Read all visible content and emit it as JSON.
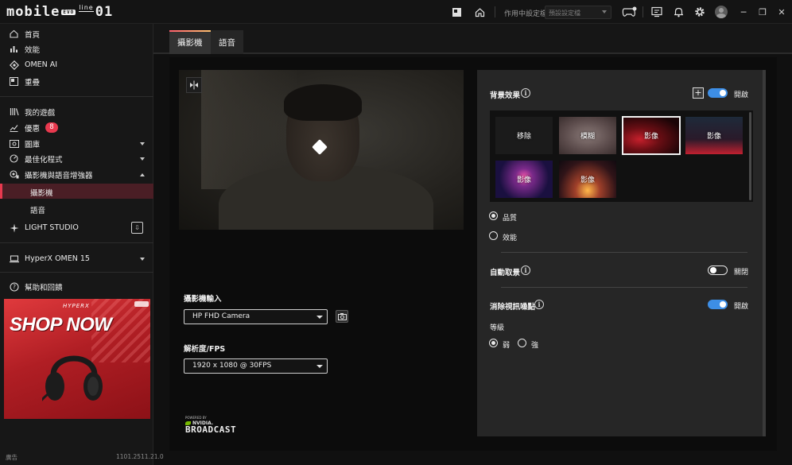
{
  "app": {
    "logo_text": "mobile",
    "logo_evo": "EVO",
    "logo_line": "line",
    "logo_suffix": "01",
    "profile_label": "作用中設定檔",
    "profile_value": "預設設定檔"
  },
  "sidebar": {
    "items": [
      {
        "label": "首頁",
        "icon": "home-icon"
      },
      {
        "label": "效能",
        "icon": "performance-icon"
      },
      {
        "label": "OMEN AI",
        "icon": "omen-ai-icon"
      },
      {
        "label": "重疊",
        "icon": "overlay-icon"
      },
      {
        "label": "我的遊戲",
        "icon": "games-library-icon"
      },
      {
        "label": "優惠",
        "icon": "offers-icon",
        "badge": "8"
      },
      {
        "label": "圖庫",
        "icon": "gallery-icon"
      },
      {
        "label": "最佳化程式",
        "icon": "optimizer-icon"
      },
      {
        "label": "攝影機與語音增強器",
        "icon": "camera-voice-icon"
      },
      {
        "label": "LIGHT STUDIO",
        "icon": "light-studio-icon"
      },
      {
        "label": "HyperX OMEN 15",
        "icon": "laptop-icon"
      },
      {
        "label": "幫助和回饋",
        "icon": "help-icon"
      }
    ],
    "sub_items": [
      {
        "label": "攝影機",
        "active": true
      },
      {
        "label": "語音",
        "active": false
      }
    ],
    "ad": {
      "brand": "HYPERX",
      "headline": "SHOP NOW"
    },
    "footer_left": "廣告",
    "footer_version": "1101.2511.21.0"
  },
  "tabs": [
    {
      "label": "攝影機",
      "active": true
    },
    {
      "label": "語音",
      "active": false
    }
  ],
  "camera": {
    "input_label": "攝影機輸入",
    "input_value": "HP FHD Camera",
    "resolution_label": "解析度/FPS",
    "resolution_value": "1920 x 1080 @ 30FPS",
    "nvidia_powered": "POWERED BY",
    "nvidia_name": "NVIDIA.",
    "nvidia_product": "BROADCAST"
  },
  "panel": {
    "background_effect_label": "背景效果",
    "background_effect_state": "開啟",
    "thumbs": [
      {
        "label": "移除"
      },
      {
        "label": "模糊"
      },
      {
        "label": "影像",
        "selected": true
      },
      {
        "label": "影像"
      },
      {
        "label": "影像"
      },
      {
        "label": "影像"
      }
    ],
    "quality_options": [
      {
        "label": "品質",
        "checked": true
      },
      {
        "label": "效能",
        "checked": false
      }
    ],
    "auto_frame_label": "自動取景",
    "auto_frame_state": "關閉",
    "noise_label": "消除視訊噪點",
    "noise_state": "開啟",
    "level_label": "等級",
    "level_options": [
      {
        "label": "弱",
        "checked": true
      },
      {
        "label": "強",
        "checked": false
      }
    ]
  },
  "colors": {
    "accent_red": "#e8394e",
    "toggle_blue": "#3d8ee6",
    "active_row": "#4a1e25"
  }
}
